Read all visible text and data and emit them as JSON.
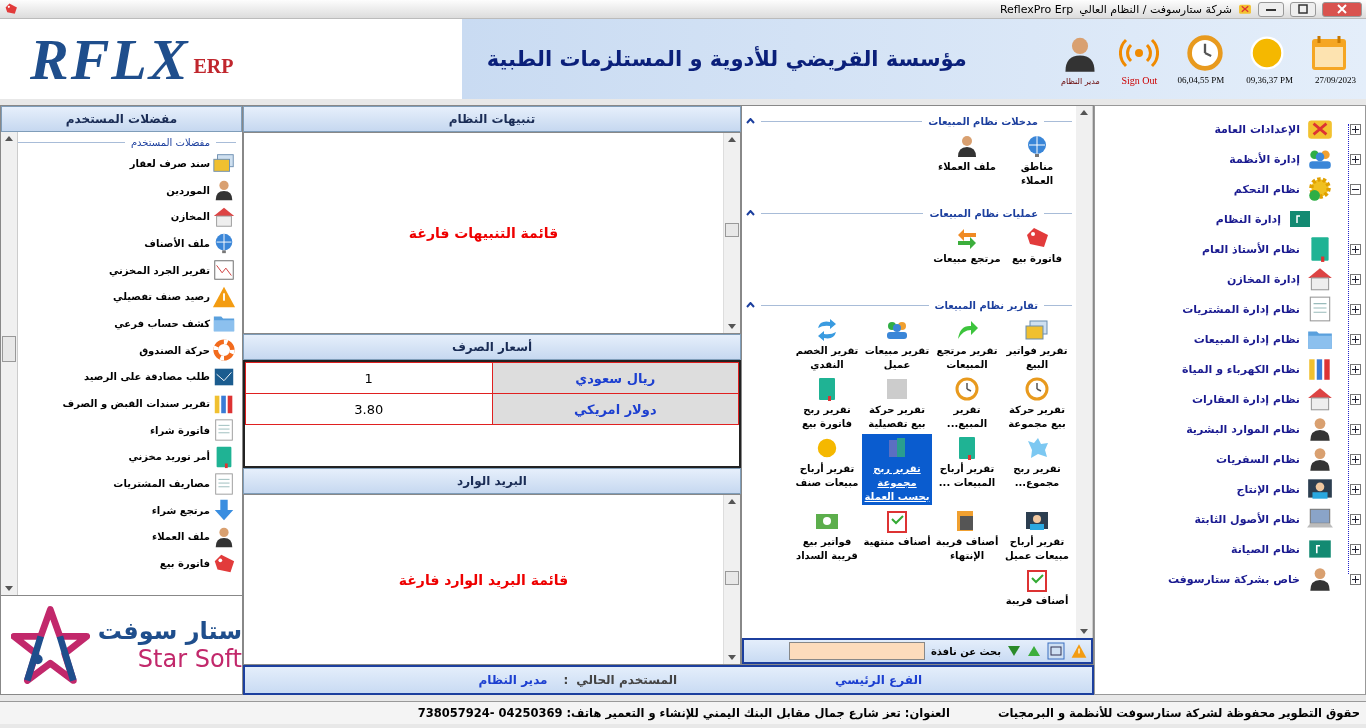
{
  "title_bar": {
    "title": "ReflexPro Erp",
    "subtitle": "شركة ستارسوفت / النظام العالي"
  },
  "header": {
    "logo": {
      "name": "RFLX",
      "suffix": "ERP"
    },
    "company": "مؤسسة القريضي للأدوية و المستلزمات الطبية",
    "user": "مدير النظام",
    "sign_out": "Sign Out",
    "times": [
      "27/09/2023",
      "09,36,37 PM",
      "06,04,55 PM"
    ]
  },
  "sidebar": {
    "items": [
      {
        "label": "الإعدادات العامة",
        "expanded": false
      },
      {
        "label": "إدارة الأنظمة",
        "expanded": false
      },
      {
        "label": "نظام التحكم",
        "expanded": true,
        "children": [
          {
            "label": "إدارة النظام"
          }
        ]
      },
      {
        "label": "نظام الأستاذ العام",
        "expanded": false
      },
      {
        "label": "إدارة المخازن",
        "expanded": false
      },
      {
        "label": "نظام إدارة المشتريات",
        "expanded": false
      },
      {
        "label": "نظام إدارة المبيعات",
        "expanded": false
      },
      {
        "label": "نظام الكهرباء و المياة",
        "expanded": false
      },
      {
        "label": "نظام إدارة العقارات",
        "expanded": false
      },
      {
        "label": "نظام الموارد البشرية",
        "expanded": false
      },
      {
        "label": "نظام السفريات",
        "expanded": false
      },
      {
        "label": "نظام الإنتاج",
        "expanded": false
      },
      {
        "label": "نظام الأصول الثابتة",
        "expanded": false
      },
      {
        "label": "نظام الصيانة",
        "expanded": false
      },
      {
        "label": "خاص بشركة ستارسوفت",
        "expanded": false
      }
    ]
  },
  "sales": {
    "sections": [
      {
        "title": "مدخلات نظام المبيعات",
        "expanded": true,
        "items": [
          {
            "label": "مناطق العملاء",
            "selected": false
          },
          {
            "label": "ملف العملاء",
            "selected": false
          }
        ]
      },
      {
        "title": "عمليات نظام المبيعات",
        "expanded": true,
        "items": [
          {
            "label": "فاتورة بيع",
            "selected": false
          },
          {
            "label": "مرتجع مبيعات",
            "selected": false
          }
        ]
      },
      {
        "title": "تقارير نظام المبيعات",
        "expanded": true,
        "items": [
          {
            "label": "تقرير فواتير البيع",
            "selected": false
          },
          {
            "label": "تقرير مرتجع المبيعات",
            "selected": false
          },
          {
            "label": "تقرير مبيعات عميل",
            "selected": false
          },
          {
            "label": "تقرير الخصم النقدي",
            "selected": false
          },
          {
            "label": "تقرير حركة بيع مجموعة",
            "selected": false
          },
          {
            "label": "تقرير المبيع...",
            "selected": false
          },
          {
            "label": "تقرير حركة بيع تفصيلية",
            "selected": false
          },
          {
            "label": "تقرير ربح فاتورة بيع",
            "selected": false
          },
          {
            "label": "تقرير ربح مجموع...",
            "selected": false
          },
          {
            "label": "تقرير أرباح المبيعات ...",
            "selected": false
          },
          {
            "label": "تقرير ربح مجموعة بحسب العملة",
            "selected": true
          },
          {
            "label": "تقرير أرباح مبيعات صنف",
            "selected": false
          },
          {
            "label": "تقرير أرباح مبيعات عميل",
            "selected": false
          },
          {
            "label": "أصناف قريبة الإنتهاء",
            "selected": false
          },
          {
            "label": "أصناف منتهية",
            "selected": false
          },
          {
            "label": "فواتير بيع قريبة السداد",
            "selected": false
          },
          {
            "label": "أصناف قريبة",
            "selected": false
          }
        ]
      }
    ],
    "search": {
      "label": "بحث عن نافذة"
    }
  },
  "alerts": {
    "title": "تنبيهات النظام",
    "empty": "قائمة التنبيهات فارغة"
  },
  "exchange": {
    "title": "أسعار الصرف",
    "rows": [
      {
        "currency": "ريال سعودي",
        "rate": "1"
      },
      {
        "currency": "دولار امريكي",
        "rate": "3.80"
      }
    ]
  },
  "mail": {
    "title": "البريد الوارد",
    "empty": "قائمة البريد الوارد فارغة"
  },
  "favorites": {
    "title": "مفضلات المستخدم",
    "group": "مفضلات المستخدم",
    "items": [
      "سند صرف لعقار",
      "الموردين",
      "المخازن",
      "ملف الأصناف",
      "تقرير الجرد المخزني",
      "رصيد صنف تفصيلي",
      "كشف حساب فرعي",
      "حركة الصندوق",
      "طلب مصادقة على الرصيد",
      "تقرير سندات القبض و الصرف",
      "فاتورة شراء",
      "أمر توريد مخزني",
      "مصاريف المشتريات",
      "مرتجع شراء",
      "ملف العملاء",
      "فاتورة بيع"
    ],
    "brand": {
      "arabic": "ستار سوفت",
      "latin": "Star Soft"
    }
  },
  "user_bar": {
    "branch": "الفرع الرئيسي",
    "user_label": "المستخدم الحالي",
    "separator": ":",
    "user": "مدير النظام"
  },
  "footer": {
    "copyright": "حقوق التطوير محفوظة لشركة ستارسوفت للأنظمة و البرمجيات",
    "address": "العنوان: تعز شارع جمال مقابل البنك اليمني للإنشاء و التعمير  هاتف: 04250369 -738057924"
  }
}
